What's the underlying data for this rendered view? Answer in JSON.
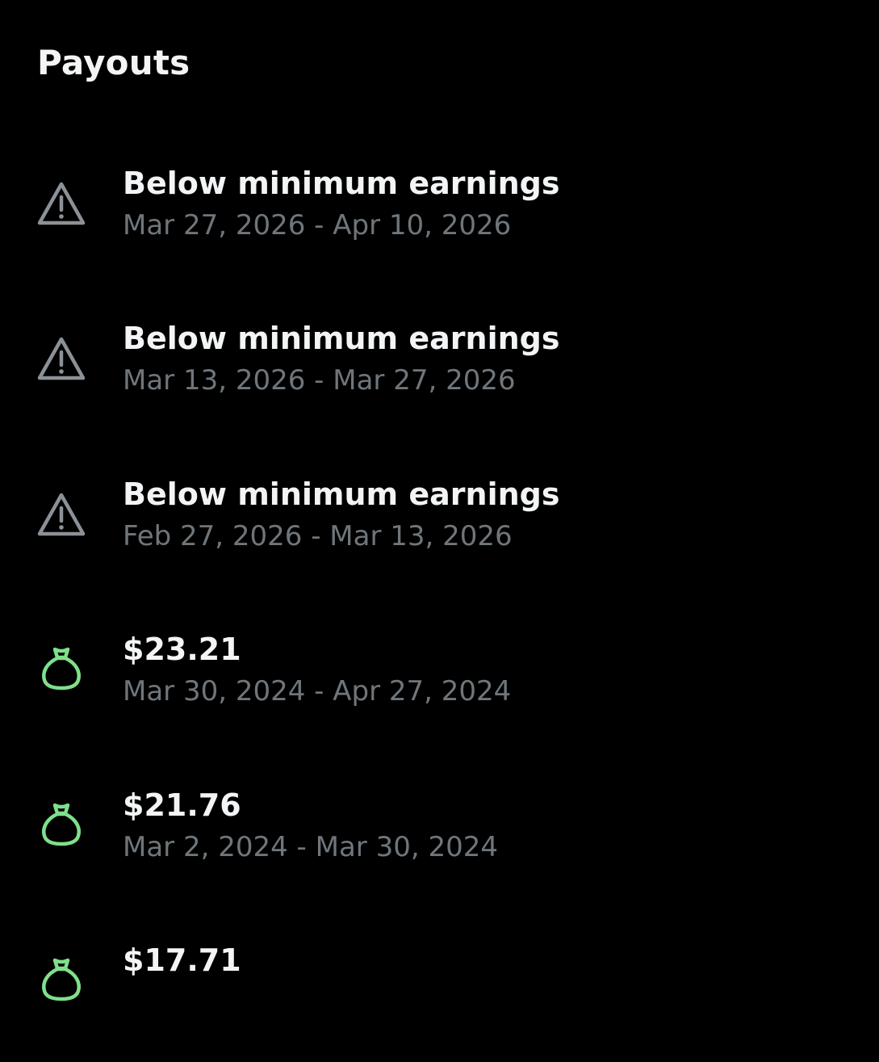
{
  "header": {
    "title": "Payouts"
  },
  "colors": {
    "background": "#000000",
    "title_text": "#f2f4f5",
    "secondary_text": "#6f767b",
    "warning_icon": "#8b9196",
    "money_icon": "#7fe08a"
  },
  "payouts": [
    {
      "icon": "warning-icon",
      "title": "Below minimum earnings",
      "dates": "Mar 27, 2026 - Apr 10, 2026"
    },
    {
      "icon": "warning-icon",
      "title": "Below minimum earnings",
      "dates": "Mar 13, 2026 - Mar 27, 2026"
    },
    {
      "icon": "warning-icon",
      "title": "Below minimum earnings",
      "dates": "Feb 27, 2026 - Mar 13, 2026"
    },
    {
      "icon": "money-bag-icon",
      "title": "$23.21",
      "dates": "Mar 30, 2024 - Apr 27, 2024"
    },
    {
      "icon": "money-bag-icon",
      "title": "$21.76",
      "dates": "Mar 2, 2024 - Mar 30, 2024"
    },
    {
      "icon": "money-bag-icon",
      "title": "$17.71",
      "dates": ""
    }
  ]
}
